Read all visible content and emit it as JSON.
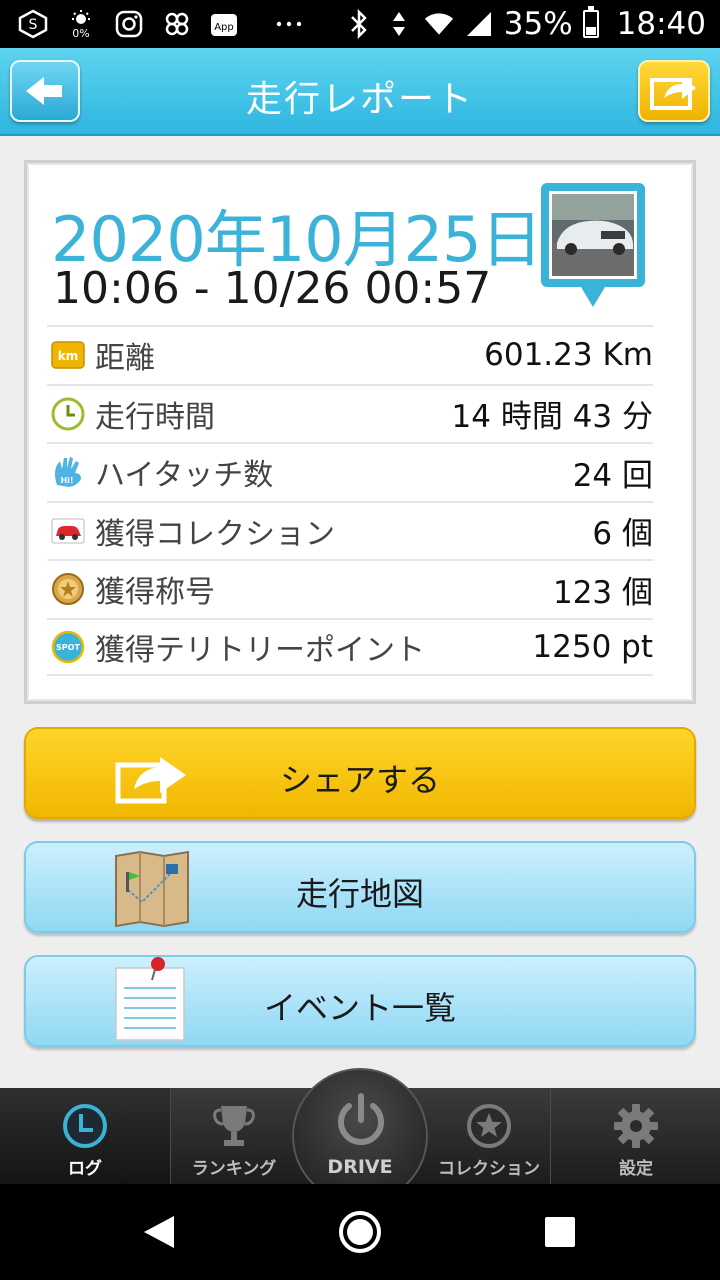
{
  "status_bar": {
    "battery_percent": "35%",
    "time": "18:40",
    "left_icons": [
      "s-app-icon",
      "brightness-icon",
      "instagram-icon",
      "pinwheel-icon",
      "app-badge-icon",
      "more-dots-icon"
    ],
    "brightness_label": "0%",
    "app_badge_label": "App",
    "battery_level": 0.35
  },
  "header": {
    "title": "走行レポート",
    "back_icon": "arrow-left-icon",
    "share_icon": "share-arrow-icon"
  },
  "report": {
    "date": "2020年10月25日",
    "time_range": "10:06 - 10/26 00:57",
    "stats": [
      {
        "icon": "km-icon",
        "icon_text": "km",
        "label": "距離",
        "value": "601.23 Km"
      },
      {
        "icon": "clock-icon",
        "label": "走行時間",
        "value": "14 時間 43 分"
      },
      {
        "icon": "high-five-icon",
        "icon_text": "Hi!",
        "label": "ハイタッチ数",
        "value": "24 回"
      },
      {
        "icon": "car-icon",
        "label": "獲得コレクション",
        "value": "6 個"
      },
      {
        "icon": "medal-icon",
        "label": "獲得称号",
        "value": "123 個"
      },
      {
        "icon": "spot-icon",
        "icon_text": "SPOT",
        "label": "獲得テリトリーポイント",
        "value": "1250 pt"
      }
    ]
  },
  "actions": {
    "share_label": "シェアする",
    "map_label": "走行地図",
    "events_label": "イベント一覧"
  },
  "tabs": [
    {
      "label": "ログ",
      "icon": "clock-tab-icon",
      "active": true
    },
    {
      "label": "ランキング",
      "icon": "trophy-icon",
      "active": false
    },
    {
      "label": "DRIVE",
      "icon": "power-icon",
      "active": false
    },
    {
      "label": "コレクション",
      "icon": "star-badge-icon",
      "active": false
    },
    {
      "label": "設定",
      "icon": "gear-icon",
      "active": false
    }
  ],
  "colors": {
    "header": "#3dbfe6",
    "date": "#3bb2d8",
    "share_button": "#f6c40f",
    "map_button": "#a6e0f6",
    "tab_active": "#3bb2d8"
  }
}
